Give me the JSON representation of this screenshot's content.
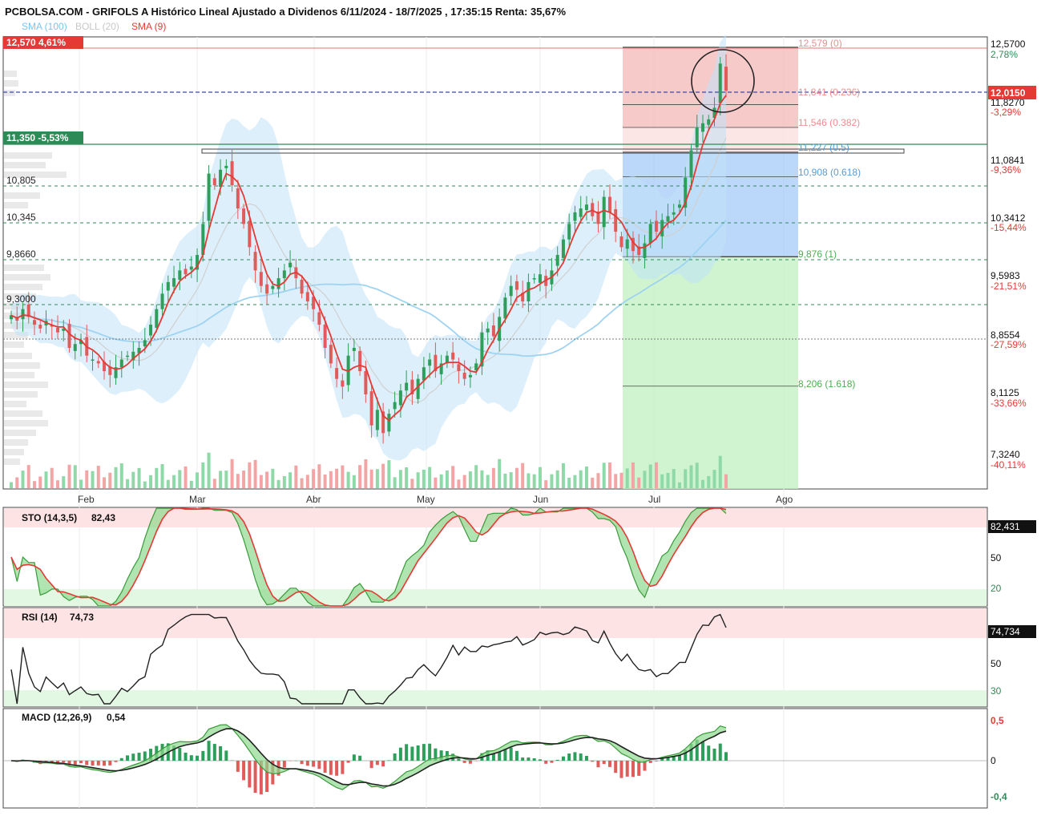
{
  "title": "PCBOLSA.COM - GRIFOLS A Histórico Lineal Ajustado a Dividenos 6/11/2024 - 18/7/2025 , 17:35:15 Renta: 35,67%",
  "legend": [
    {
      "text": "SMA (100)",
      "color": "#7cc4ef"
    },
    {
      "text": "BOLL (20)",
      "color": "#c8c8c8"
    },
    {
      "text": "SMA (9)",
      "color": "#e53935"
    }
  ],
  "months": [
    "Feb",
    "Mar",
    "Abr",
    "May",
    "Jun",
    "Jul",
    "Ago"
  ],
  "price_axis": {
    "ticks": [
      "12,5700",
      "11,8270",
      "11,0841",
      "10,3412",
      "9,5983",
      "8,8554",
      "8,1125",
      "7,3240"
    ],
    "pct": [
      "2,78%",
      "-3,29%",
      "-9,36%",
      "-15,44%",
      "-21,51%",
      "-27,59%",
      "-33,66%",
      "-40,11%"
    ],
    "current": "12,0150"
  },
  "left_tags": [
    {
      "text": "12,570  4,61%",
      "color": "#e53935"
    },
    {
      "text": "11,350  -5,53%",
      "color": "#2e8b57"
    }
  ],
  "level_labels": [
    "10,805",
    "10,345",
    "9,8660",
    "9,3000"
  ],
  "fibonacci": [
    {
      "label": "12,579 (0)",
      "value": 12.579,
      "color": "#ec8f8f"
    },
    {
      "label": "11,841 (0.236)",
      "value": 11.841,
      "color": "#ec8f8f"
    },
    {
      "label": "11,546 (0.382)",
      "value": 11.546,
      "color": "#ec8f8f"
    },
    {
      "label": "11,227 (0.5)",
      "value": 11.227,
      "color": "#5b9bd5"
    },
    {
      "label": "10,908 (0.618)",
      "value": 10.908,
      "color": "#5b9bd5"
    },
    {
      "label": "9,876 (1)",
      "value": 9.876,
      "color": "#4caf50"
    },
    {
      "label": "8,206 (1.618)",
      "value": 8.206,
      "color": "#4caf50"
    }
  ],
  "sto": {
    "label": "STO (14,3,5)",
    "value": "82,43",
    "axis_value": "82,431",
    "ticks": [
      "50",
      "20"
    ]
  },
  "rsi": {
    "label": "RSI (14)",
    "value": "74,73",
    "axis_value": "74,734",
    "ticks": [
      "50",
      "30"
    ]
  },
  "macd": {
    "label": "MACD (12,26,9)",
    "value": "0,54",
    "ticks": [
      "0,5",
      "0",
      "-0,4"
    ]
  },
  "chart_data": {
    "type": "candlestick",
    "x_range": [
      "2024-11-06",
      "2025-07-18"
    ],
    "y_range": [
      7.32,
      12.8
    ],
    "close": [
      9.12,
      9.05,
      9.2,
      9.1,
      9.0,
      8.95,
      9.05,
      8.98,
      8.9,
      8.95,
      8.7,
      8.75,
      8.8,
      8.6,
      8.55,
      8.5,
      8.4,
      8.35,
      8.45,
      8.55,
      8.6,
      8.65,
      8.7,
      8.8,
      9.0,
      9.2,
      9.4,
      9.55,
      9.6,
      9.7,
      9.65,
      9.75,
      9.9,
      10.3,
      10.95,
      10.8,
      11.0,
      11.05,
      10.8,
      10.5,
      10.3,
      10.0,
      9.7,
      9.5,
      9.4,
      9.5,
      9.6,
      9.7,
      9.8,
      9.6,
      9.4,
      9.3,
      9.2,
      9.0,
      8.7,
      8.5,
      8.3,
      8.2,
      8.6,
      8.7,
      8.4,
      8.1,
      7.7,
      7.9,
      7.6,
      7.85,
      8.0,
      8.15,
      8.25,
      8.1,
      8.3,
      8.45,
      8.55,
      8.4,
      8.5,
      8.6,
      8.55,
      8.4,
      8.3,
      8.35,
      8.5,
      8.9,
      8.95,
      8.85,
      9.1,
      9.35,
      9.5,
      9.45,
      9.3,
      9.55,
      9.6,
      9.65,
      9.5,
      9.7,
      9.9,
      10.1,
      10.3,
      10.45,
      10.5,
      10.55,
      10.4,
      10.3,
      10.65,
      10.45,
      10.2,
      10.0,
      10.1,
      9.95,
      9.9,
      10.05,
      10.3,
      10.2,
      10.35,
      10.4,
      10.45,
      10.55,
      10.9,
      11.25,
      11.55,
      11.6,
      11.65,
      11.8,
      12.37,
      12.02
    ]
  }
}
